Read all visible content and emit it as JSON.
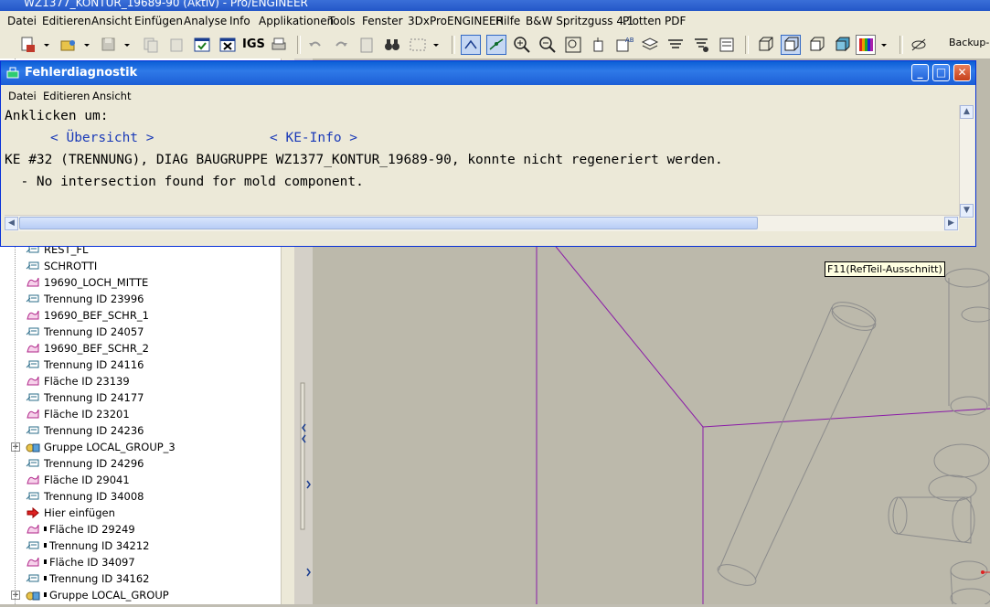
{
  "app": {
    "title": "WZ1377_KONTUR_19689-90 (Aktiv) - Pro/ENGINEER"
  },
  "menubar": [
    "Datei",
    "Editieren",
    "Ansicht",
    "Einfügen",
    "Analyse",
    "Info",
    "Applikationen",
    "Tools",
    "Fenster",
    "3DxProENGINEER",
    "Hilfe",
    "B&W Spritzguss 4.1",
    "Plotten",
    "PDF"
  ],
  "toolbar": {
    "igs_label": "IGS",
    "backup_label": "Backup-M"
  },
  "dialog": {
    "title": "Fehlerdiagnostik",
    "menu": [
      "Datei",
      "Editieren",
      "Ansicht"
    ],
    "line1": "Anklicken um:",
    "link_overview": "< Übersicht >",
    "link_keinfo": "< KE-Info >",
    "line3": "KE #32 (TRENNUNG), DIAG BAUGRUPPE WZ1377_KONTUR_19689-90, konnte nicht regeneriert werden.",
    "line4": "  - No intersection found for mold component.",
    "buttons": {
      "minimize": "_",
      "maximize": "□",
      "close": "✕"
    }
  },
  "tree": {
    "items": [
      {
        "label": "REST_FL",
        "icon": "trennung-icon"
      },
      {
        "label": "SCHROTTI",
        "icon": "trennung-icon"
      },
      {
        "label": "19690_LOCH_MITTE",
        "icon": "flaeche-icon"
      },
      {
        "label": "Trennung ID 23996",
        "icon": "trennung-icon"
      },
      {
        "label": "19690_BEF_SCHR_1",
        "icon": "flaeche-icon"
      },
      {
        "label": "Trennung ID 24057",
        "icon": "trennung-icon"
      },
      {
        "label": "19690_BEF_SCHR_2",
        "icon": "flaeche-icon"
      },
      {
        "label": "Trennung ID 24116",
        "icon": "trennung-icon"
      },
      {
        "label": "Fläche ID 23139",
        "icon": "flaeche-icon"
      },
      {
        "label": "Trennung ID 24177",
        "icon": "trennung-icon"
      },
      {
        "label": "Fläche ID 23201",
        "icon": "flaeche-icon"
      },
      {
        "label": "Trennung ID 24236",
        "icon": "trennung-icon"
      },
      {
        "label": "Gruppe LOCAL_GROUP_3",
        "icon": "group-icon",
        "expandable": true
      },
      {
        "label": "Trennung ID 24296",
        "icon": "trennung-icon"
      },
      {
        "label": "Fläche ID 29041",
        "icon": "flaeche-icon"
      },
      {
        "label": "Trennung ID 34008",
        "icon": "trennung-icon"
      },
      {
        "label": "Hier einfügen",
        "icon": "insert-here-arrow-icon"
      },
      {
        "label": "Fläche ID 29249",
        "icon": "flaeche-icon",
        "suppressed": true
      },
      {
        "label": "Trennung ID 34212",
        "icon": "trennung-icon",
        "suppressed": true
      },
      {
        "label": "Fläche ID 34097",
        "icon": "flaeche-icon",
        "suppressed": true
      },
      {
        "label": "Trennung ID 34162",
        "icon": "trennung-icon",
        "suppressed": true
      },
      {
        "label": "Gruppe LOCAL_GROUP",
        "icon": "group-icon",
        "expandable": true,
        "suppressed": true
      }
    ]
  },
  "graphics": {
    "tooltip": "F11(RefTeil-Ausschnitt)"
  },
  "colors": {
    "title_blue": "#0a5ed6",
    "datum_line": "#8a1aa8",
    "link": "#1a3ab8"
  }
}
